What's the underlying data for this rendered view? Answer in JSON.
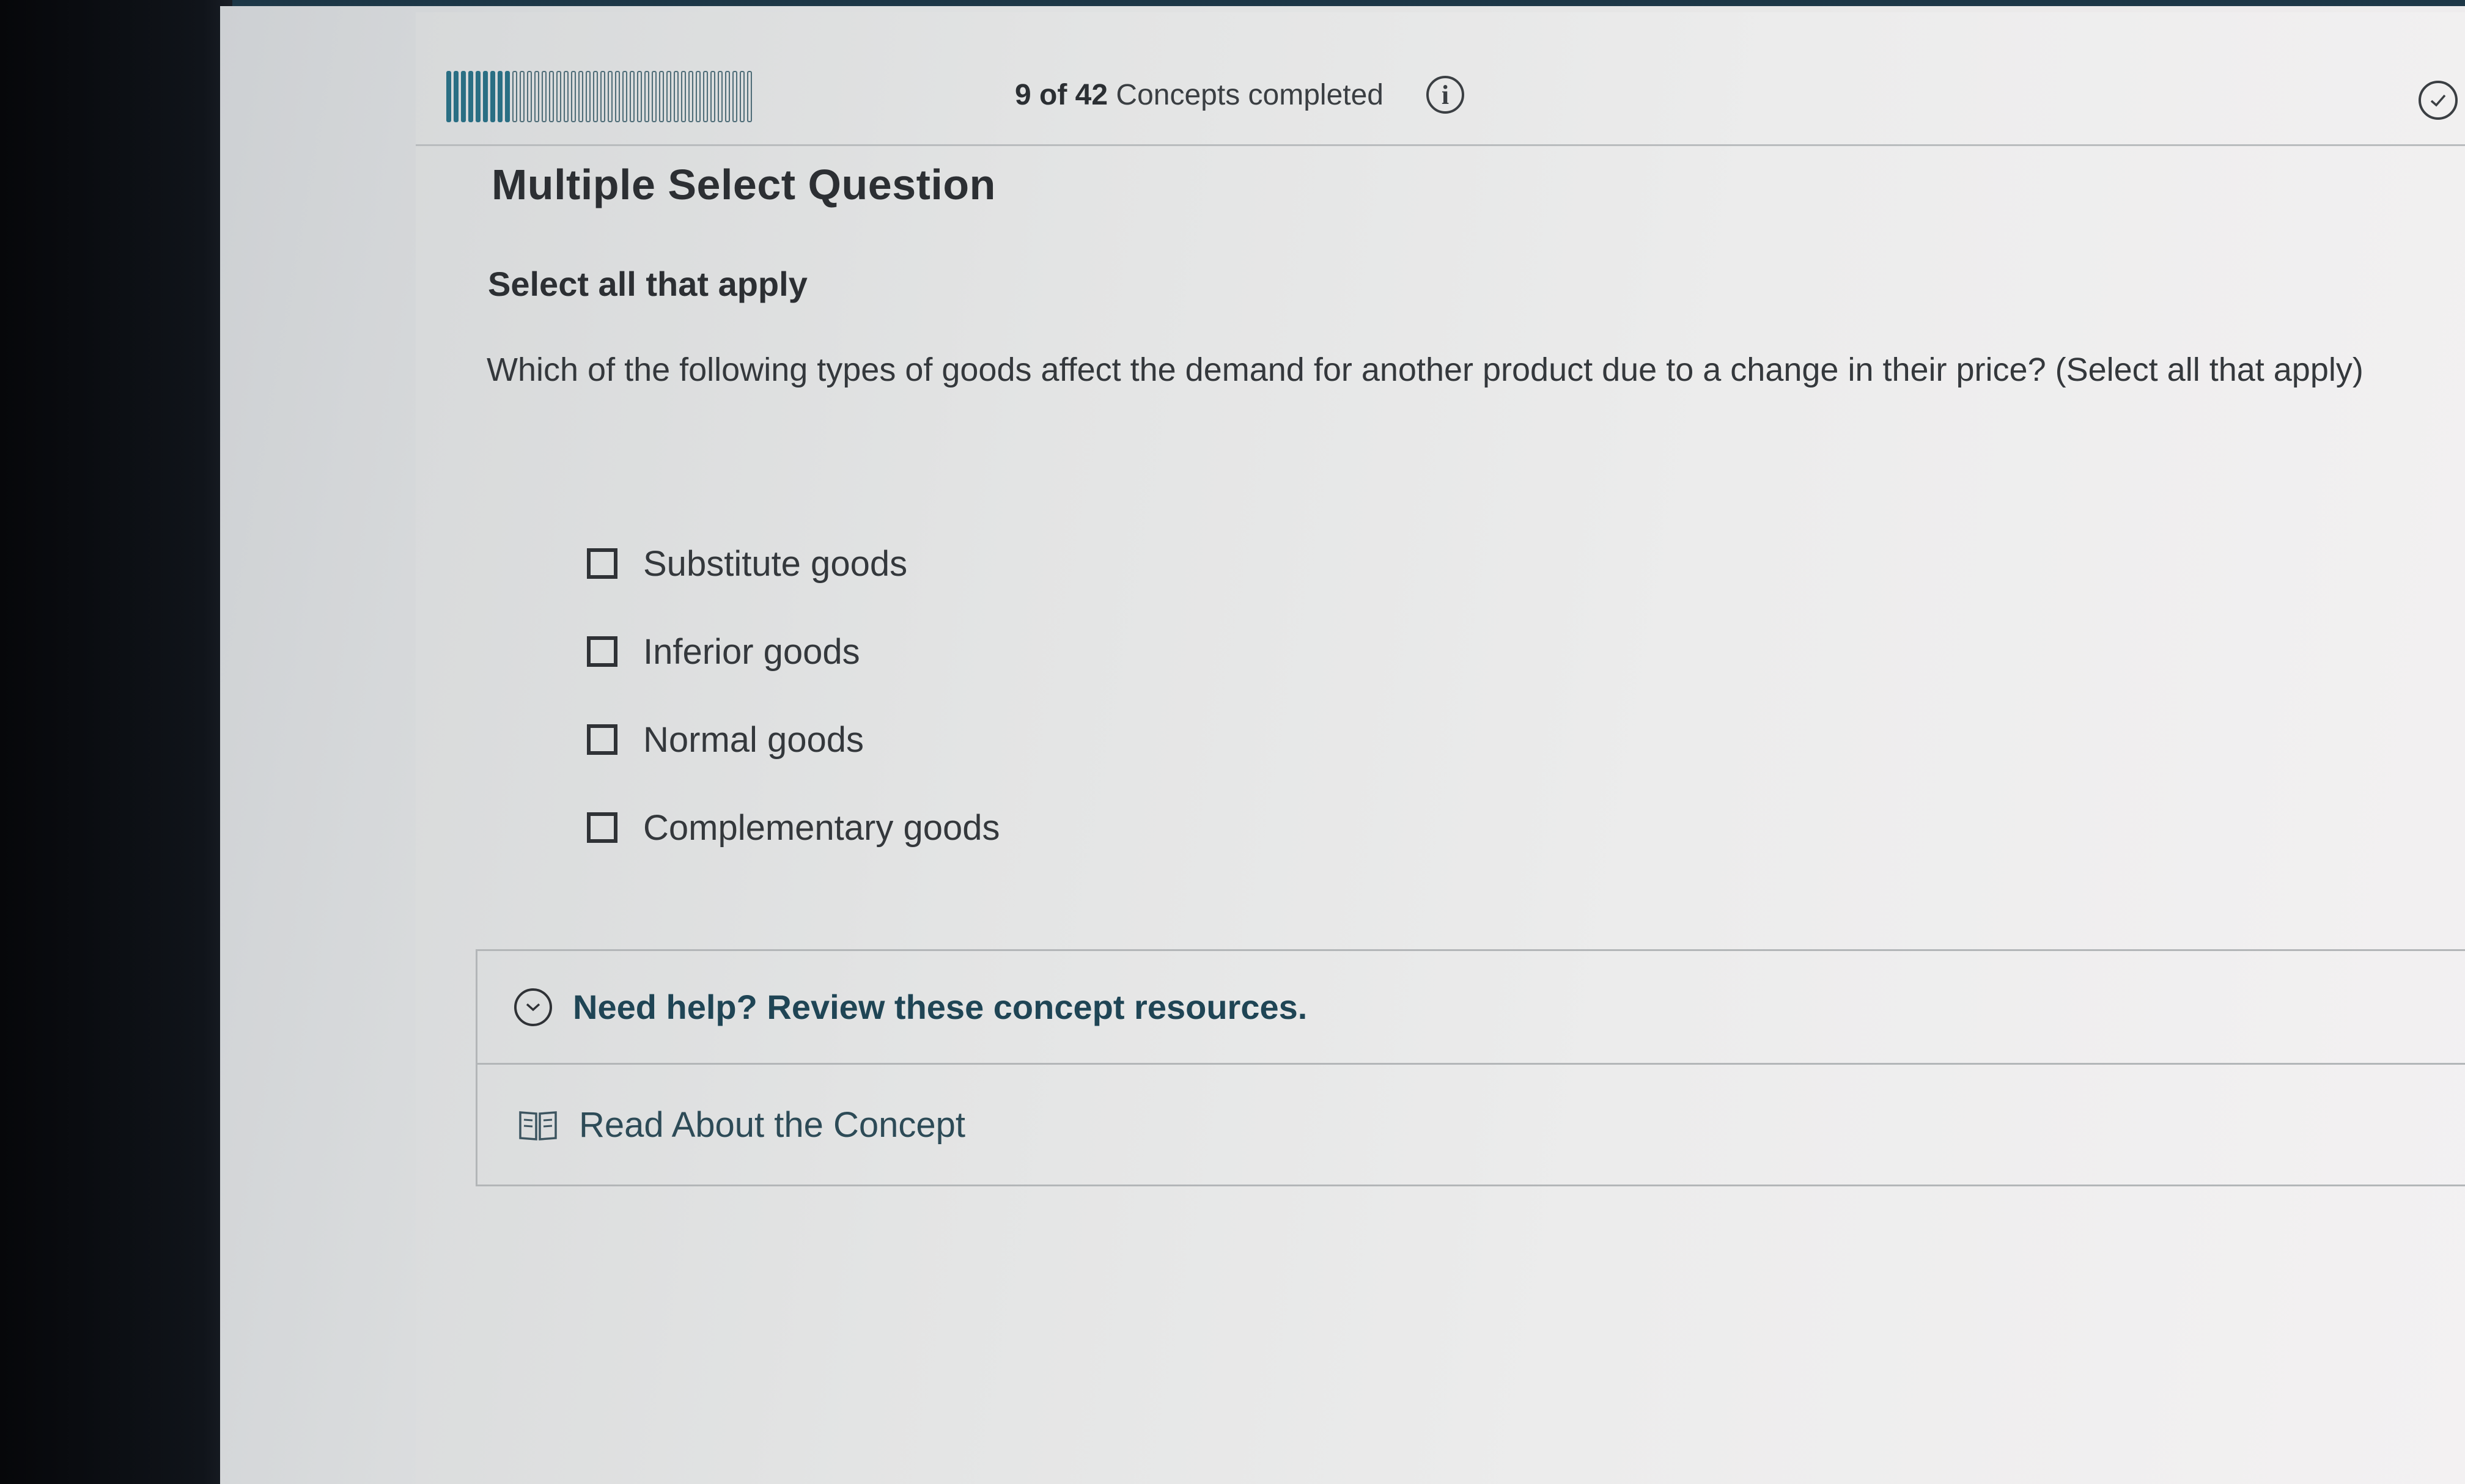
{
  "progress": {
    "completed": 9,
    "total": 42,
    "count_text": "9 of 42",
    "suffix_text": "Concepts completed",
    "fill_fraction": 0.214
  },
  "question": {
    "type_label": "Multiple Select Question",
    "instructions": "Select all that apply",
    "prompt": "Which of the following types of goods affect the demand for another product due to a change in their price? (Select all that apply)"
  },
  "options": [
    {
      "label": "Substitute goods",
      "checked": false
    },
    {
      "label": "Inferior goods",
      "checked": false
    },
    {
      "label": "Normal goods",
      "checked": false
    },
    {
      "label": "Complementary goods",
      "checked": false
    }
  ],
  "help": {
    "title": "Need help? Review these concept resources.",
    "read_link": "Read About the Concept"
  },
  "icons": {
    "info": "info-icon",
    "complete": "check-circle-icon",
    "expand": "chevron-down-circle-icon",
    "read": "book-icon"
  },
  "colors": {
    "progress_fill": "#2a6f84",
    "help_title": "#1f4555"
  }
}
